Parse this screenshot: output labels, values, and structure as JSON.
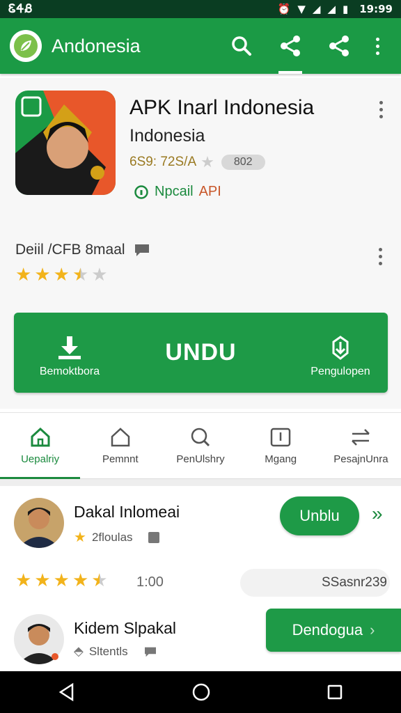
{
  "status_bar": {
    "left_text": "ᏋᏎᏰ",
    "time": "19:99"
  },
  "app_bar": {
    "title": "Andonesia",
    "actions": [
      "search-icon",
      "share-icon",
      "share-icon",
      "more-vert-icon"
    ]
  },
  "app": {
    "name": "APK Inarl Indonesia",
    "subtitle": "Indonesia",
    "rating_text": "6S9: 72S/A",
    "badge": "802",
    "tag_green": "Npcail",
    "tag_orange": "API"
  },
  "review": {
    "title": "Deiil /CFB 8maal",
    "stars": 3.5
  },
  "download": {
    "left_label": "Bemoktbora",
    "main_label": "UNDU",
    "right_label": "Pengulopen"
  },
  "tabs": [
    {
      "label": "Uepalriy",
      "icon": "home-icon",
      "active": true
    },
    {
      "label": "Pemnnt",
      "icon": "house-outline-icon",
      "active": false
    },
    {
      "label": "PenUlshry",
      "icon": "search-heart-icon",
      "active": false
    },
    {
      "label": "Mgang",
      "icon": "device-icon",
      "active": false
    },
    {
      "label": "PesajnUnra",
      "icon": "switch-icon",
      "active": false
    }
  ],
  "list": [
    {
      "name": "Dakal Inlomeai",
      "sub": "2floulas",
      "button": "Unblu",
      "rating": 4.5,
      "rating_text": "1:00",
      "side_text": "SSasnr239"
    },
    {
      "name": "Kidem Slpakal",
      "sub": "Sltentls",
      "button": "Dendogua"
    }
  ],
  "colors": {
    "primary": "#1b9a45",
    "status": "#0a3d22",
    "star": "#f2b31b"
  }
}
